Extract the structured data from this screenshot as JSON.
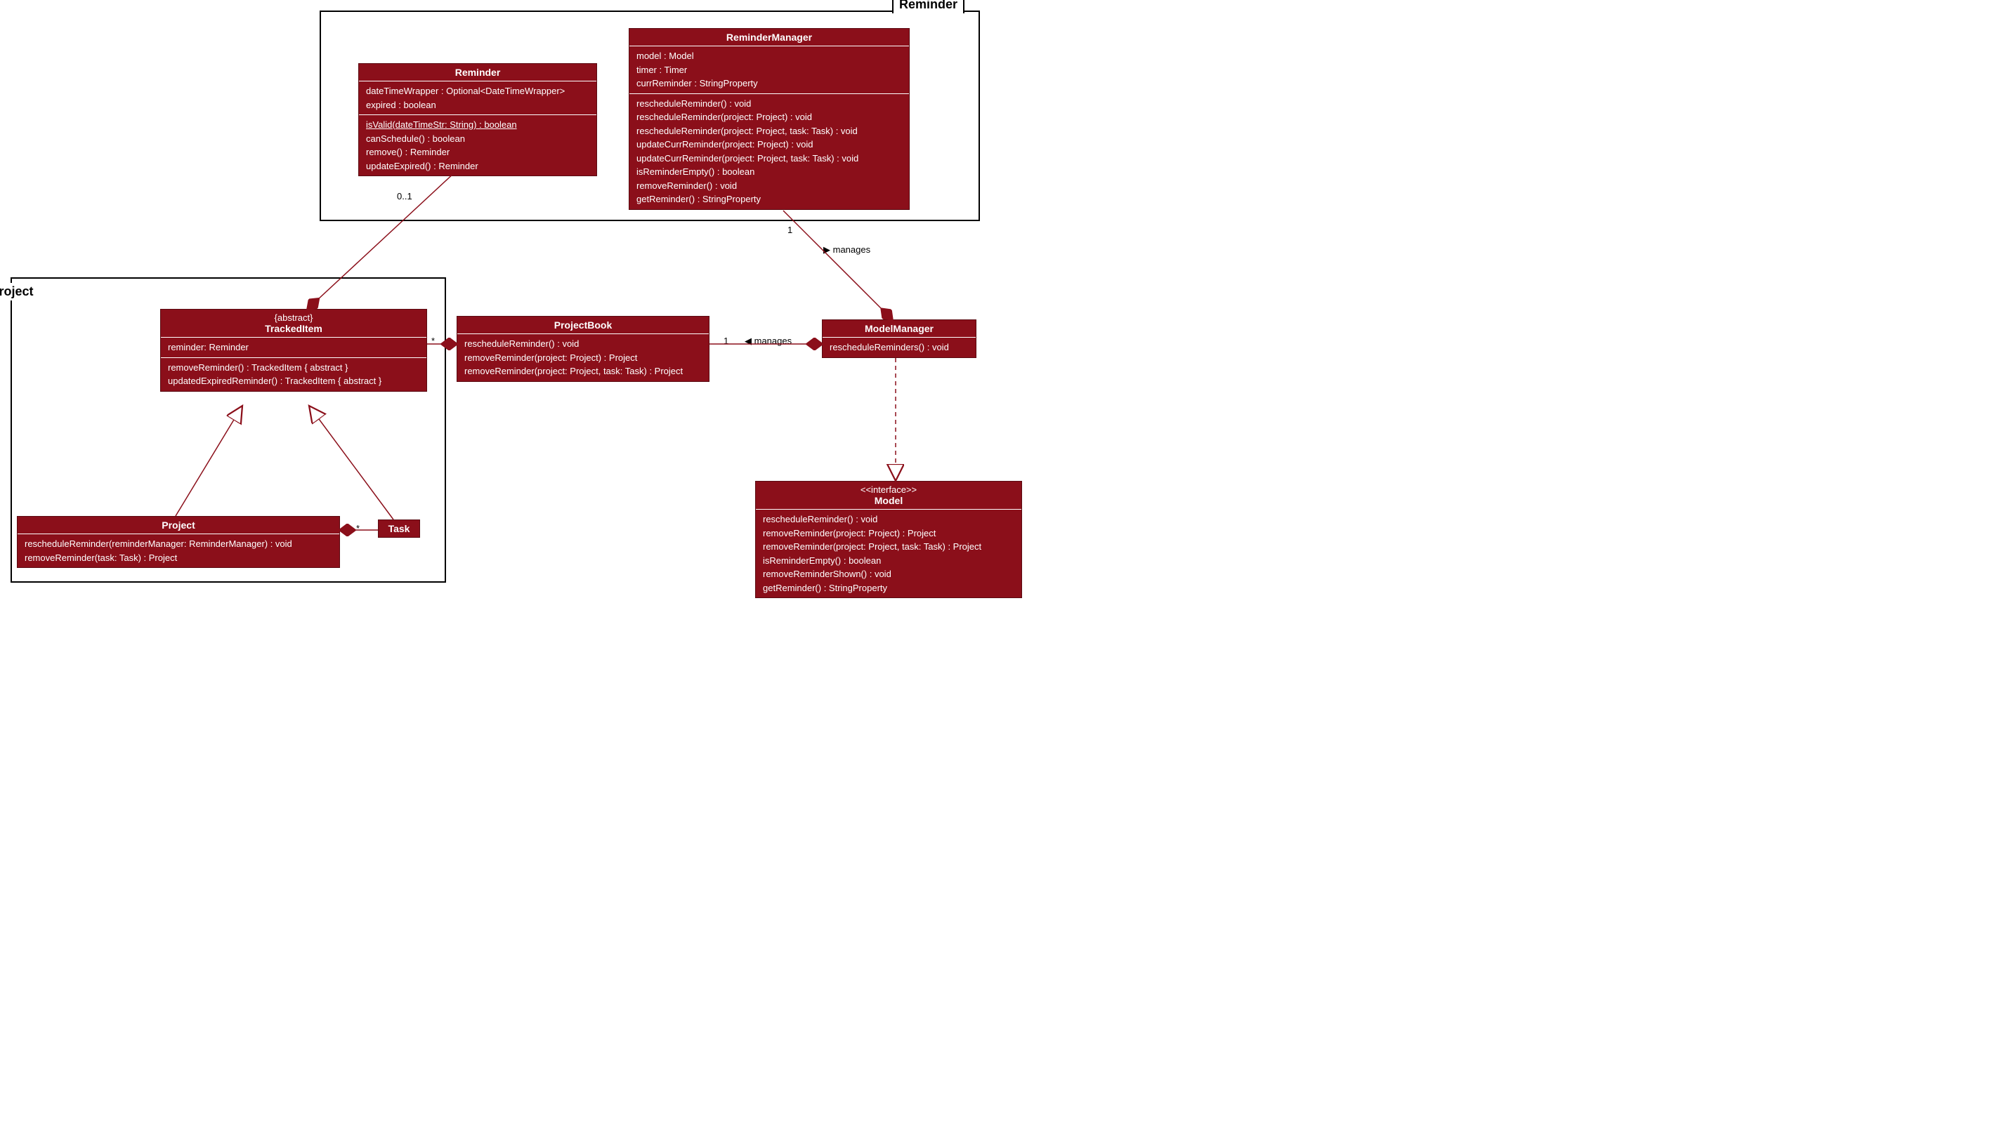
{
  "packages": {
    "reminder": {
      "label": "Reminder"
    },
    "project": {
      "label": "Project"
    }
  },
  "reminder_class": {
    "name": "Reminder",
    "attrs": {
      "a0": "dateTimeWrapper : Optional<DateTimeWrapper>",
      "a1": "expired : boolean"
    },
    "ops": {
      "o0": "isValid(dateTimeStr: String) : boolean",
      "o1": "canSchedule() : boolean",
      "o2": "remove() : Reminder",
      "o3": "updateExpired() : Reminder"
    }
  },
  "reminder_manager": {
    "name": "ReminderManager",
    "attrs": {
      "a0": "model : Model",
      "a1": "timer : Timer",
      "a2": "currReminder : StringProperty"
    },
    "ops": {
      "o0": "rescheduleReminder() : void",
      "o1": "rescheduleReminder(project: Project) : void",
      "o2": "rescheduleReminder(project: Project, task: Task) : void",
      "o3": "updateCurrReminder(project: Project) : void",
      "o4": "updateCurrReminder(project: Project, task: Task) : void",
      "o5": "isReminderEmpty() : boolean",
      "o6": "removeReminder() : void",
      "o7": "getReminder() : StringProperty"
    }
  },
  "tracked_item": {
    "stereotype": "{abstract}",
    "name": "TrackedItem",
    "attrs": {
      "a0": "reminder: Reminder"
    },
    "ops": {
      "o0": "removeReminder() : TrackedItem { abstract }",
      "o1": "updatedExpiredReminder() : TrackedItem { abstract }"
    }
  },
  "project_class": {
    "name": "Project",
    "ops": {
      "o0": "rescheduleReminder(reminderManager: ReminderManager) : void",
      "o1": "removeReminder(task: Task) : Project"
    }
  },
  "task_class": {
    "name": "Task"
  },
  "project_book": {
    "name": "ProjectBook",
    "ops": {
      "o0": "rescheduleReminder() : void",
      "o1": "removeReminder(project: Project) : Project",
      "o2": "removeReminder(project: Project, task: Task) : Project"
    }
  },
  "model_manager": {
    "name": "ModelManager",
    "ops": {
      "o0": "rescheduleReminders() : void"
    }
  },
  "model_interface": {
    "stereotype": "<<interface>>",
    "name": "Model",
    "ops": {
      "o0": "rescheduleReminder() : void",
      "o1": "removeReminder(project: Project) : Project",
      "o2": "removeReminder(project: Project, task: Task) : Project",
      "o3": "isReminderEmpty() : boolean",
      "o4": "removeReminderShown() : void",
      "o5": "getReminder() : StringProperty"
    }
  },
  "labels": {
    "mult_reminder": "0..1",
    "mult_rm_mgr": "1",
    "manages1": "manages",
    "mult_pb": "1",
    "manages2": "manages",
    "mult_ti": "*",
    "mult_task": "*"
  }
}
